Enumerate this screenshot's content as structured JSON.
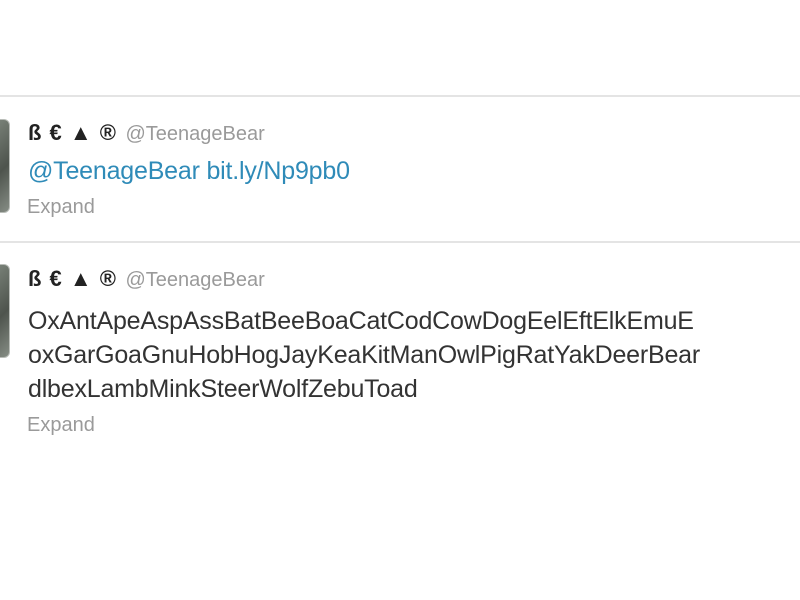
{
  "timeline": {
    "tweets": [
      {
        "fullname": "ß € ▲ ®",
        "username": "@TeenageBear",
        "mention": "@TeenageBear",
        "url": "bit.ly/Np9pb0",
        "expand_label": "Expand"
      },
      {
        "fullname": "ß € ▲ ®",
        "username": "@TeenageBear",
        "text_lines": [
          "OxAntApeAspAssBatBeeBoaCatCodCowDogEelEftElkEmuE",
          "oxGarGoaGnuHobHogJayKeaKitManOwlPigRatYakDeerBear",
          "dlbexLambMinkSteerWolfZebuToad"
        ],
        "expand_label": "Expand"
      }
    ]
  },
  "colors": {
    "link": "#2f8bb8",
    "muted": "#9a9a9a",
    "text": "#333333",
    "divider": "#e4e4e4"
  }
}
